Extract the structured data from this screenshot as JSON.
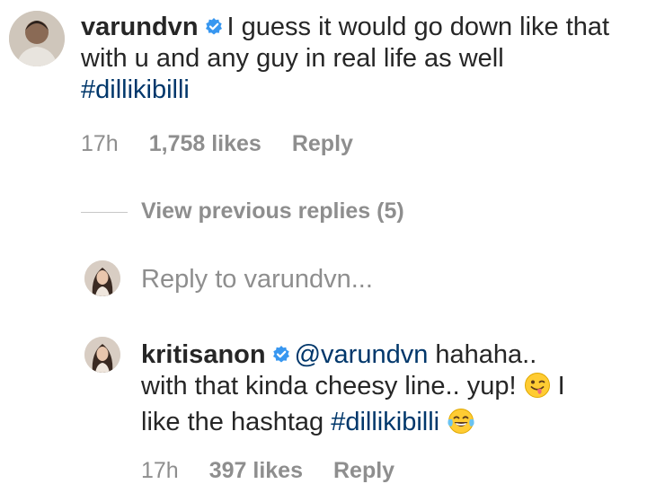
{
  "comment1": {
    "username": "varundvn",
    "text": "I guess it would go down like that with u and any guy in real life as well",
    "hashtag": "#dillikibilli",
    "time": "17h",
    "likes": "1,758 likes",
    "reply_label": "Reply"
  },
  "view_replies": {
    "label": "View previous replies (5)"
  },
  "reply_input": {
    "prefix": "Reply to",
    "target": "varundvn..."
  },
  "comment2": {
    "username": "kritisanon",
    "mention": "@varundvn",
    "text1": "hahaha..",
    "text2": "with that kinda cheesy line.. yup!",
    "text3": "I",
    "text4": "like the hashtag",
    "hashtag": "#dillikibilli",
    "time": "17h",
    "likes": "397 likes",
    "reply_label": "Reply"
  },
  "icons": {
    "verified": "verified-badge-icon",
    "wink_tongue": "winking-face-with-tongue-emoji",
    "laughing": "face-with-tears-of-joy-emoji"
  },
  "colors": {
    "verified_blue": "#3897f0",
    "link": "#00376b",
    "muted": "#8e8e8e"
  }
}
